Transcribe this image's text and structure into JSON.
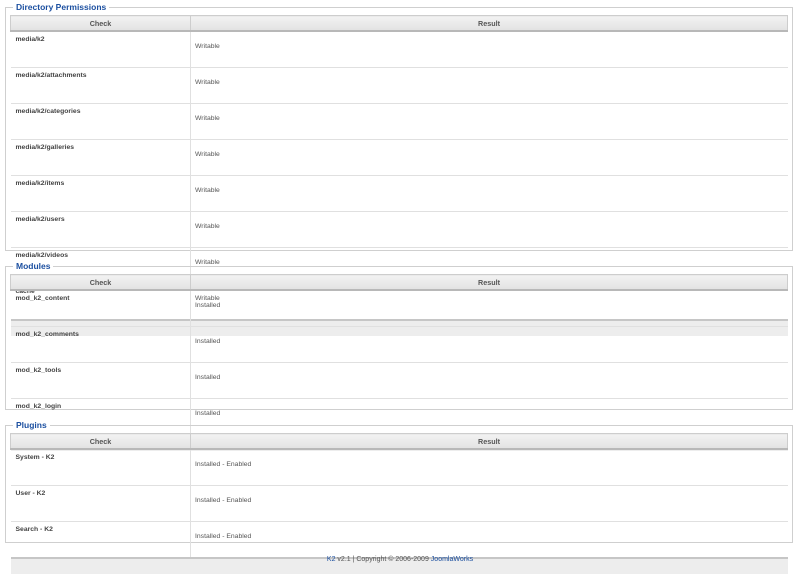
{
  "columns": {
    "check": "Check",
    "result": "Result"
  },
  "directory_permissions": {
    "title": "Directory Permissions",
    "rows": [
      {
        "check": "media/k2",
        "result": "Writable"
      },
      {
        "check": "media/k2/attachments",
        "result": "Writable"
      },
      {
        "check": "media/k2/categories",
        "result": "Writable"
      },
      {
        "check": "media/k2/galleries",
        "result": "Writable"
      },
      {
        "check": "media/k2/items",
        "result": "Writable"
      },
      {
        "check": "media/k2/users",
        "result": "Writable"
      },
      {
        "check": "media/k2/videos",
        "result": "Writable"
      },
      {
        "check": "cache",
        "result": "Writable"
      }
    ]
  },
  "modules": {
    "title": "Modules",
    "rows": [
      {
        "check": "mod_k2_content",
        "result": "Installed"
      },
      {
        "check": "mod_k2_comments",
        "result": "Installed"
      },
      {
        "check": "mod_k2_tools",
        "result": "Installed"
      },
      {
        "check": "mod_k2_login",
        "result": "Installed"
      }
    ]
  },
  "plugins": {
    "title": "Plugins",
    "rows": [
      {
        "check": "System - K2",
        "result": "Installed - Enabled"
      },
      {
        "check": "User - K2",
        "result": "Installed - Enabled"
      },
      {
        "check": "Search - K2",
        "result": "Installed - Enabled"
      }
    ]
  },
  "footer": {
    "product": "K2",
    "version_text": "v2.1 | Copyright © 2006-2009",
    "company": "JoomlaWorks"
  },
  "colors": {
    "accent": "#1b4fa0",
    "header_bg": "#e8e8e8",
    "footer_bar_bg": "#ededed"
  }
}
